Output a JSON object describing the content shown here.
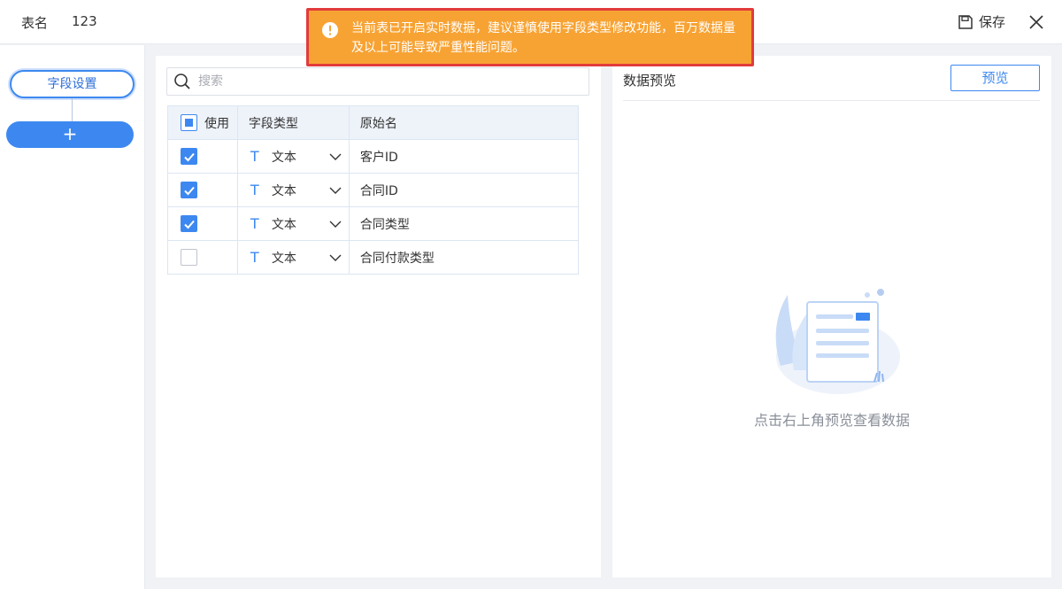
{
  "header": {
    "table_name_label": "表名",
    "table_name_value": "123",
    "save_label": "保存",
    "icons": {
      "save": "floppy-disk-icon",
      "close": "close-icon"
    }
  },
  "toast": {
    "message": "当前表已开启实时数据，建议谨慎使用字段类型修改功能，百万数据量及以上可能导致严重性能问题。",
    "icon": "exclamation-circle-icon",
    "background": "#f7a334",
    "highlight_border": "#e23b3b"
  },
  "sidebar": {
    "step_label": "字段设置",
    "add_label": "+"
  },
  "fields": {
    "search_placeholder": "搜索",
    "columns": {
      "use": "使用",
      "type": "字段类型",
      "original_name": "原始名"
    },
    "rows": [
      {
        "checked": true,
        "type_icon": "T",
        "type": "文本",
        "name": "客户ID"
      },
      {
        "checked": true,
        "type_icon": "T",
        "type": "文本",
        "name": "合同ID"
      },
      {
        "checked": true,
        "type_icon": "T",
        "type": "文本",
        "name": "合同类型"
      },
      {
        "checked": false,
        "type_icon": "T",
        "type": "文本",
        "name": "合同付款类型"
      }
    ]
  },
  "preview": {
    "title": "数据预览",
    "button_label": "预览",
    "empty_text": "点击右上角预览查看数据"
  },
  "colors": {
    "primary": "#3d88f0",
    "header_bg": "#eef3fa",
    "border": "#dbe6f3"
  }
}
